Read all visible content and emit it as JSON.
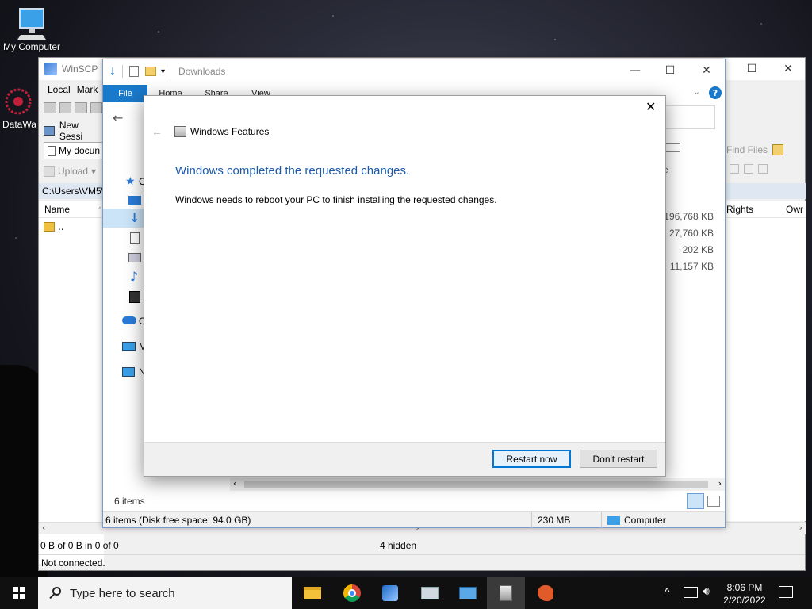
{
  "desktop": {
    "icons": [
      {
        "label": "My Computer"
      },
      {
        "label": "DataWa"
      }
    ]
  },
  "winscp": {
    "title": "WinSCP",
    "menu": [
      "Local",
      "Mark"
    ],
    "new_session": "New Sessi",
    "location": "My docun",
    "upload_label": "Upload",
    "path": "C:\\Users\\VM5\\",
    "col_name": "Name",
    "parent_dir": "..",
    "right_cols": [
      "Rights",
      "Owr"
    ],
    "find_files": "Find Files",
    "status_line1": "0 B of 0 B in 0 of 0",
    "hidden": "4 hidden",
    "status_line2": "Not connected."
  },
  "explorer": {
    "title": "Downloads",
    "tabs": [
      "File",
      "Home",
      "Share",
      "View"
    ],
    "sidebar_letters": [
      "C",
      "O",
      "M",
      "N"
    ],
    "col_size": "ze",
    "sizes": [
      "196,768 KB",
      "27,760 KB",
      "202 KB",
      "11,157 KB"
    ],
    "items_count": "6 items",
    "status_left": "6 items (Disk free space: 94.0 GB)",
    "status_mid": "230 MB",
    "status_right": "Computer"
  },
  "dialog": {
    "title": "Windows Features",
    "heading": "Windows completed the requested changes.",
    "message": "Windows needs to reboot your PC to finish installing the requested changes.",
    "restart_label": "Restart now",
    "dont_restart_label": "Don't restart",
    "accent": "#1e5aa8"
  },
  "taskbar": {
    "search_placeholder": "Type here to search",
    "time": "8:06 PM",
    "date": "2/20/2022",
    "apps": [
      "file-explorer-icon",
      "chrome-icon",
      "winscp-app-icon",
      "monitor-app-icon",
      "control-panel-icon",
      "windows-features-icon",
      "paint-app-icon"
    ]
  }
}
